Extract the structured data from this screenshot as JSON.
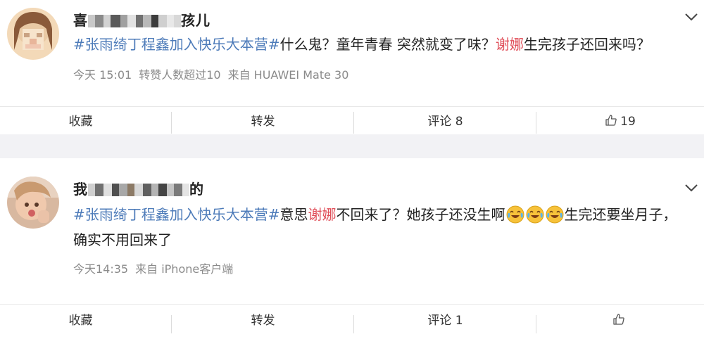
{
  "posts": [
    {
      "username_start": "喜",
      "username_end": "孩儿",
      "text": {
        "hashtag": "#张雨绮丁程鑫加入快乐大本营#",
        "part1": "什么鬼？童年青春 突然就变了味？",
        "mention": "谢娜",
        "part2": "生完孩子还回来吗？"
      },
      "meta": {
        "time": "今天 15:01",
        "reposts": "转赞人数超过10",
        "source": "来自 HUAWEI Mate 30"
      },
      "actions": {
        "favorite": "收藏",
        "repost": "转发",
        "comment": "评论 8",
        "like_count": "19"
      }
    },
    {
      "username_start": "我",
      "username_end": "的",
      "text": {
        "hashtag": "#张雨绮丁程鑫加入快乐大本营#",
        "part1": "意思",
        "mention": "谢娜",
        "part2": "不回来了？她孩子还没生啊",
        "part3": "生完还要坐月子，确实不用回来了"
      },
      "meta": {
        "time": "今天14:35",
        "source": "来自 iPhone客户端"
      },
      "actions": {
        "favorite": "收藏",
        "repost": "转发",
        "comment": "评论 1",
        "like_count": ""
      }
    }
  ],
  "colors": {
    "hashtag": "#4d7bb9",
    "mention": "#e0505a",
    "meta": "#8a8a8a",
    "separator": "#f2f2f5"
  },
  "icons": [
    "avatar",
    "chevron-down-icon",
    "thumbs-up-icon",
    "laugh-cry-emoji-icon"
  ]
}
